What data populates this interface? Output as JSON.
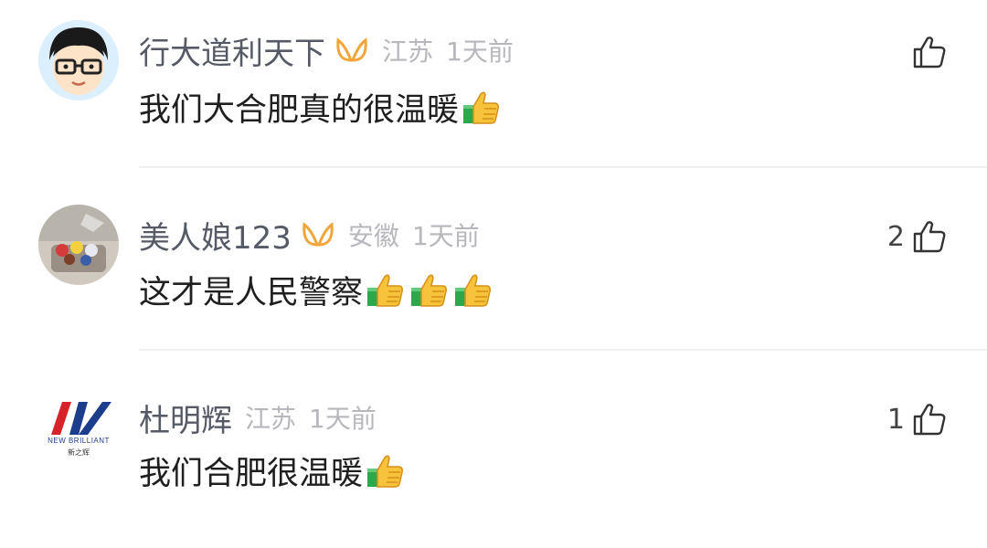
{
  "comments": [
    {
      "username": "行大道利天下",
      "location": "江苏",
      "time": "1天前",
      "text": "我们大合肥真的很温暖",
      "thumbs": 1,
      "likes": "",
      "avatar_icon": "cartoon-boy-avatar",
      "badge_icon": "vip-badge-icon"
    },
    {
      "username": "美人娘123",
      "location": "安徽",
      "time": "1天前",
      "text": "这才是人民警察",
      "thumbs": 3,
      "likes": "2",
      "avatar_icon": "cupcakes-photo-avatar",
      "badge_icon": "vip-badge-icon"
    },
    {
      "username": "杜明辉",
      "location": "江苏",
      "time": "1天前",
      "text": "我们合肥很温暖",
      "thumbs": 1,
      "likes": "1",
      "avatar_icon": "new-brilliant-logo-avatar",
      "logo_text": "NEW BRILLIANT",
      "logo_subtext": "新之辉"
    }
  ],
  "colors": {
    "username": "#555a66",
    "meta": "#b7b7bd",
    "text": "#1f1f1f",
    "vip_badge": "#f2a53a",
    "logo_red": "#d8222a",
    "logo_blue": "#1c3c8c"
  }
}
